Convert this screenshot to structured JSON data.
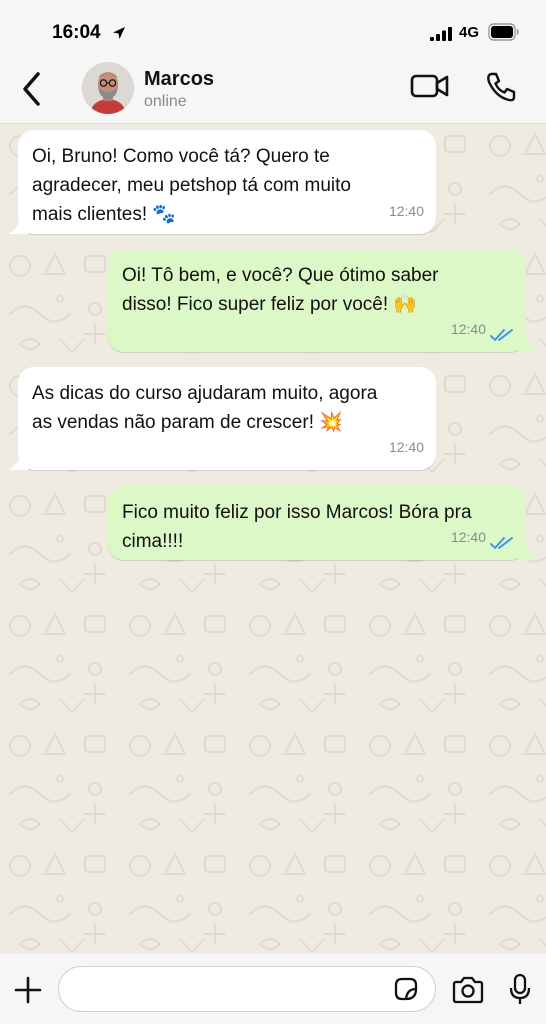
{
  "status_bar": {
    "time": "16:04",
    "network": "4G",
    "icons": [
      "location-arrow-icon",
      "signal-bars-icon",
      "battery-icon"
    ]
  },
  "header": {
    "contact_name": "Marcos",
    "contact_status": "online",
    "icons": [
      "back-chevron-icon",
      "avatar-photo",
      "video-call-icon",
      "phone-icon"
    ]
  },
  "messages": [
    {
      "direction": "incoming",
      "lines": [
        "Oi, Bruno! Como você tá? Quero te",
        "agradecer, meu petshop tá com muito",
        "mais clientes! 🐾"
      ],
      "time": "12:40"
    },
    {
      "direction": "outgoing",
      "lines": [
        "Oi! Tô bem, e você? Que ótimo saber",
        "disso! Fico super feliz por você! 🙌"
      ],
      "time": "12:40",
      "status": "read"
    },
    {
      "direction": "incoming",
      "lines": [
        "As dicas do curso ajudaram muito, agora",
        "as vendas não param de crescer! 💥"
      ],
      "time": "12:40"
    },
    {
      "direction": "outgoing",
      "lines": [
        "Fico muito feliz por isso Marcos! Bóra pra",
        "cima!!!!"
      ],
      "time": "12:40",
      "status": "read"
    }
  ],
  "input_bar": {
    "placeholder": "",
    "icons": [
      "plus-icon",
      "sticker-icon",
      "camera-icon",
      "microphone-icon"
    ]
  },
  "colors": {
    "incoming_bubble": "#ffffff",
    "outgoing_bubble": "#dcf8c6",
    "chat_background": "#efeae2",
    "read_ticks": "#3a8ef0",
    "timestamp": "#8c8c8c"
  }
}
